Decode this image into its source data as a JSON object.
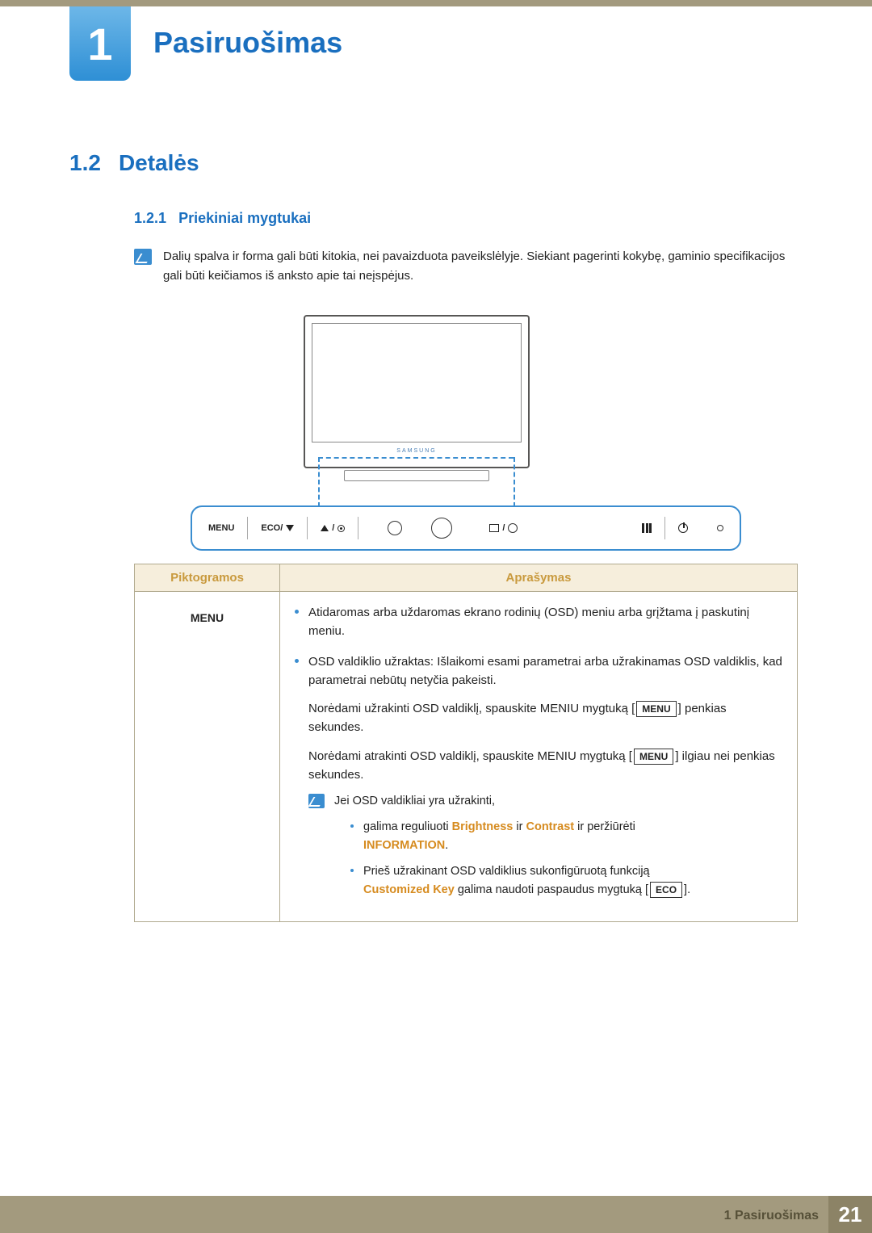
{
  "chapter": {
    "number": "1",
    "title": "Pasiruošimas"
  },
  "section": {
    "number": "1.2",
    "title": "Detalės"
  },
  "subsection": {
    "number": "1.2.1",
    "title": "Priekiniai mygtukai"
  },
  "note_text": "Dalių spalva ir forma gali būti kitokia, nei pavaizduota paveikslėlyje. Siekiant pagerinti kokybę, gaminio specifikacijos gali būti keičiamos iš anksto apie tai neįspėjus.",
  "diagram": {
    "logo": "SAMSUNG",
    "buttons": {
      "menu": "MENU",
      "eco": "ECO/",
      "menu_btn": "MENU",
      "eco_btn": "ECO"
    }
  },
  "table": {
    "headers": {
      "icons": "Piktogramos",
      "description": "Aprašymas"
    },
    "rows": [
      {
        "icon_label": "MENU",
        "bullet1": "Atidaromas arba uždaromas ekrano rodinių (OSD) meniu arba grįžtama į paskutinį meniu.",
        "bullet2": "OSD valdiklio užraktas: Išlaikomi esami parametrai arba užrakinamas OSD valdiklis, kad parametrai nebūtų netyčia pakeisti.",
        "para1_a": "Norėdami užrakinti OSD valdiklį, spauskite MENIU mygtuką [",
        "para1_btn": "MENU",
        "para1_b": "] penkias sekundes.",
        "para2_a": "Norėdami atrakinti OSD valdiklį, spauskite MENIU mygtuką [",
        "para2_btn": "MENU",
        "para2_b": "] ilgiau nei penkias sekundes.",
        "subnote_intro": "Jei OSD valdikliai yra užrakinti,",
        "sub_b1_a": "galima reguliuoti ",
        "sub_b1_hl1": "Brightness",
        "sub_b1_mid": " ir ",
        "sub_b1_hl2": "Contrast",
        "sub_b1_b": " ir peržiūrėti ",
        "sub_b1_hl3": "INFORMATION",
        "sub_b1_end": ".",
        "sub_b2_a": "Prieš užrakinant OSD valdiklius sukonfigūruotą funkciją ",
        "sub_b2_hl": "Customized Key",
        "sub_b2_b": " galima naudoti paspaudus mygtuką [",
        "sub_b2_btn": "ECO",
        "sub_b2_c": "]."
      }
    ]
  },
  "footer": {
    "breadcrumb": "1 Pasiruošimas",
    "page": "21"
  }
}
